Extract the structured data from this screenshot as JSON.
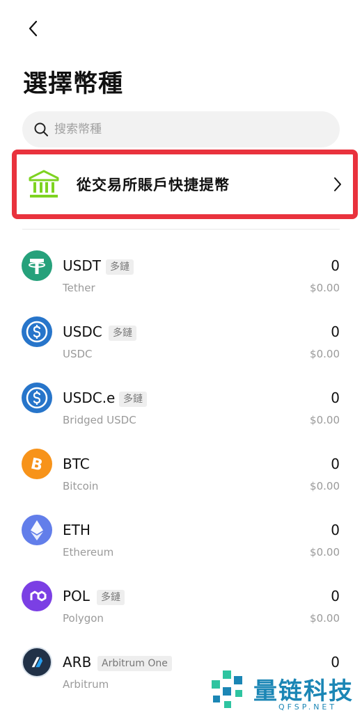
{
  "header": {
    "title": "選擇幣種"
  },
  "search": {
    "placeholder": "搜索幣種"
  },
  "quick_withdraw": {
    "label": "從交易所賬戶快捷提幣"
  },
  "tokens": [
    {
      "symbol": "USDT",
      "tag": "多鏈",
      "name": "Tether",
      "amount": "0",
      "value": "$0.00",
      "icon": "tether-icon",
      "color": "#26a17b"
    },
    {
      "symbol": "USDC",
      "tag": "多鏈",
      "name": "USDC",
      "amount": "0",
      "value": "$0.00",
      "icon": "usdc-icon",
      "color": "#2775ca"
    },
    {
      "symbol": "USDC.e",
      "tag": "多鏈",
      "name": "Bridged USDC",
      "amount": "0",
      "value": "$0.00",
      "icon": "usdc-icon",
      "color": "#2775ca"
    },
    {
      "symbol": "BTC",
      "tag": "",
      "name": "Bitcoin",
      "amount": "0",
      "value": "$0.00",
      "icon": "bitcoin-icon",
      "color": "#f7931a"
    },
    {
      "symbol": "ETH",
      "tag": "",
      "name": "Ethereum",
      "amount": "0",
      "value": "$0.00",
      "icon": "ethereum-icon",
      "color": "#627eea"
    },
    {
      "symbol": "POL",
      "tag": "多鏈",
      "name": "Polygon",
      "amount": "0",
      "value": "$0.00",
      "icon": "polygon-icon",
      "color": "#7b3fe4"
    },
    {
      "symbol": "ARB",
      "tag": "Arbitrum One",
      "name": "Arbitrum",
      "amount": "0",
      "value": "",
      "icon": "arbitrum-icon",
      "color": "#213147"
    }
  ],
  "watermark": {
    "text": "量链科技",
    "sub": "QFSP.NET"
  },
  "colors": {
    "highlight_border": "#e9323d",
    "bank_icon": "#7ed321"
  }
}
